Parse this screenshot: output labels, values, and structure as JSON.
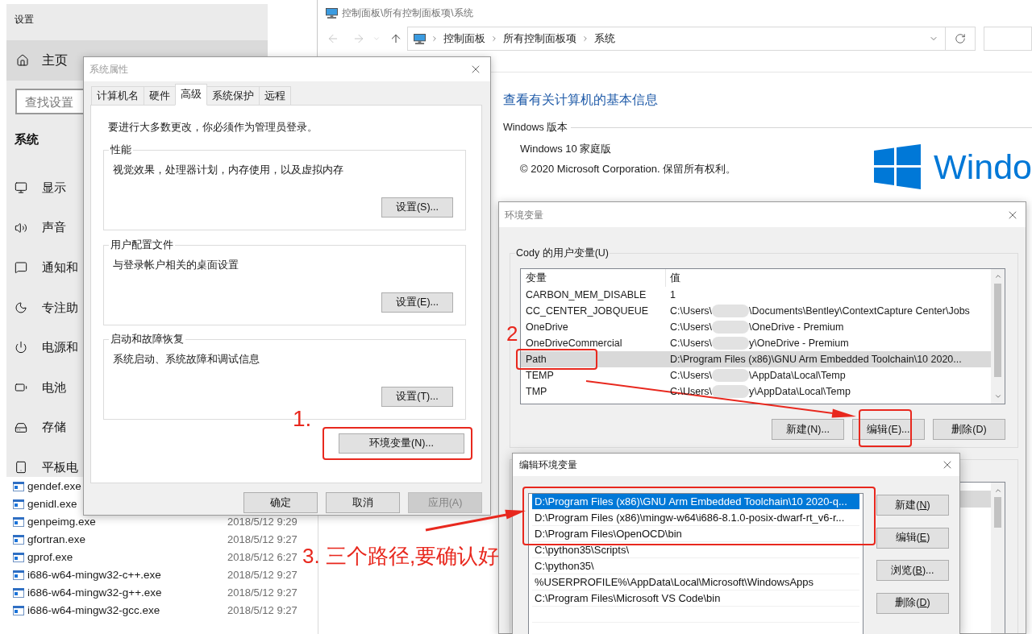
{
  "settings_window": {
    "title": "设置",
    "home": {
      "label": "主页",
      "highlighted": true
    },
    "search": {
      "placeholder": "查找设置"
    },
    "section": "系统",
    "nav_items": [
      "显示",
      "声音",
      "通知和",
      "专注助",
      "电源和",
      "电池",
      "存储",
      "平板电"
    ]
  },
  "file_list": {
    "rows": [
      {
        "name": "gendef.exe"
      },
      {
        "name": "genidl.exe"
      },
      {
        "name": "genpeimg.exe",
        "modified": "2018/5/12 9:29"
      },
      {
        "name": "gfortran.exe",
        "modified": "2018/5/12 9:27"
      },
      {
        "name": "gprof.exe",
        "modified": "2018/5/12 6:27"
      },
      {
        "name": "i686-w64-mingw32-c++.exe",
        "modified": "2018/5/12 9:27"
      },
      {
        "name": "i686-w64-mingw32-g++.exe",
        "modified": "2018/5/12 9:27"
      },
      {
        "name": "i686-w64-mingw32-gcc.exe",
        "modified": "2018/5/12 9:27"
      }
    ]
  },
  "control_panel": {
    "title": "控制面板\\所有控制面板项\\系统",
    "nav_buttons": [
      {
        "disabled": true
      },
      {
        "disabled": true
      },
      {
        "disabled": true
      },
      {
        "disabled": false
      }
    ],
    "breadcrumb": [
      "控制面板",
      "所有控制面板项",
      "系统"
    ],
    "heading": "查看有关计算机的基本信息",
    "section_label": "Windows 版本",
    "edition": "Windows 10 家庭版",
    "copyright": "© 2020 Microsoft Corporation. 保留所有权利。",
    "logo_text": "Windo"
  },
  "system_properties": {
    "title": "系统属性",
    "tabs": [
      {
        "label": "计算机名",
        "selected": false
      },
      {
        "label": "硬件",
        "selected": false
      },
      {
        "label": "高级",
        "selected": true
      },
      {
        "label": "系统保护",
        "selected": false
      },
      {
        "label": "远程",
        "selected": false
      }
    ],
    "notice": "要进行大多数更改，你必须作为管理员登录。",
    "groups": [
      {
        "title": "性能",
        "description": "视觉效果，处理器计划，内存使用，以及虚拟内存",
        "button": "设置(S)..."
      },
      {
        "title": "用户配置文件",
        "description": "与登录帐户相关的桌面设置",
        "button": "设置(E)..."
      },
      {
        "title": "启动和故障恢复",
        "description": "系统启动、系统故障和调试信息",
        "button": "设置(T)..."
      }
    ],
    "environment_button": "环境变量(N)...",
    "footer_buttons": [
      {
        "label": "确定",
        "disabled": false
      },
      {
        "label": "取消",
        "disabled": false
      },
      {
        "label": "应用(A)",
        "disabled": true
      }
    ]
  },
  "environment_variables": {
    "title": "环境变量",
    "user_group": "Cody 的用户变量(U)",
    "columns": [
      "变量",
      "值"
    ],
    "rows": [
      {
        "name": "CARBON_MEM_DISABLE",
        "value": [
          "1"
        ],
        "selected": false
      },
      {
        "name": "CC_CENTER_JOBQUEUE",
        "value": [
          "C:\\Users\\",
          "\\Documents\\Bentley\\ContextCapture Center\\Jobs"
        ],
        "selected": false
      },
      {
        "name": "OneDrive",
        "value": [
          "C:\\Users\\",
          "\\OneDrive - Premium"
        ],
        "selected": false
      },
      {
        "name": "OneDriveCommercial",
        "value": [
          "C:\\Users\\",
          "y\\OneDrive - Premium"
        ],
        "selected": false
      },
      {
        "name": "Path",
        "value": [
          "D:\\Program Files (x86)\\GNU Arm Embedded Toolchain\\10 2020..."
        ],
        "selected": true
      },
      {
        "name": "TEMP",
        "value": [
          "C:\\Users\\",
          "\\AppData\\Local\\Temp"
        ],
        "selected": false
      },
      {
        "name": "TMP",
        "value": [
          "C:\\Users\\",
          "y\\AppData\\Local\\Temp"
        ],
        "selected": false
      }
    ],
    "buttons": [
      "新建(N)...",
      "编辑(E)...",
      "删除(D)"
    ]
  },
  "edit_environment_variable": {
    "title": "编辑环境变量",
    "entries": [
      {
        "text": "D:\\Program Files (x86)\\GNU Arm Embedded Toolchain\\10 2020-q...",
        "selected": true
      },
      {
        "text": "D:\\Program Files (x86)\\mingw-w64\\i686-8.1.0-posix-dwarf-rt_v6-r...",
        "selected": false
      },
      {
        "text": "D:\\Program Files\\OpenOCD\\bin",
        "selected": false
      },
      {
        "text": "C:\\python35\\Scripts\\",
        "selected": false
      },
      {
        "text": "C:\\python35\\",
        "selected": false
      },
      {
        "text": "%USERPROFILE%\\AppData\\Local\\Microsoft\\WindowsApps",
        "selected": false
      },
      {
        "text": "C:\\Program Files\\Microsoft VS Code\\bin",
        "selected": false
      }
    ],
    "buttons": [
      {
        "text": "新建(",
        "key": "N",
        "tail": ")"
      },
      {
        "text": "编辑(",
        "key": "E",
        "tail": ")"
      },
      {
        "text": "浏览(",
        "key": "B",
        "tail": ")..."
      },
      {
        "text": "删除(",
        "key": "D",
        "tail": ")"
      }
    ]
  },
  "annotations": [
    {
      "text": "1."
    },
    {
      "text": "2"
    },
    {
      "text": "3. 三个路径,要确认好"
    }
  ]
}
